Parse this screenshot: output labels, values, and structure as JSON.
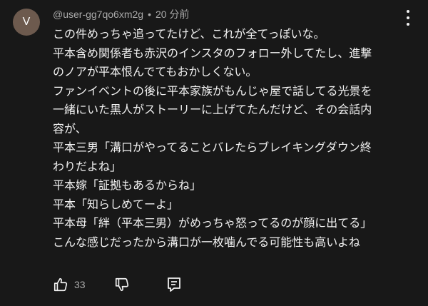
{
  "comment": {
    "avatar_letter": "V",
    "avatar_color": "#6d5a4e",
    "username": "@user-gg7qo6xm2g",
    "separator": "•",
    "timestamp": "20 分前",
    "lines": [
      "この件めっちゃ追ってたけど、これが全てっぽいな。",
      "平本含め関係者も赤沢のインスタのフォロー外してたし、進撃",
      "のノアが平本恨んでてもおかしくない。",
      "ファンイベントの後に平本家族がもんじゃ屋で話してる光景を",
      "一緒にいた黒人がストーリーに上げてたんだけど、その会話内",
      "容が、",
      "平本三男「溝口がやってることバレたらブレイキングダウン終",
      "わりだよね」",
      "平本嫁「証拠もあるからね」",
      "平本「知らしめてーよ」",
      "平本母「絆（平本三男）がめっちゃ怒ってるのが顔に出てる」",
      "こんな感じだったから溝口が一枚噛んでる可能性も高いよね"
    ],
    "like_count": "33"
  },
  "icons": {
    "menu": "more-vert-icon",
    "like": "thumbs-up-icon",
    "dislike": "thumbs-down-icon",
    "reply": "reply-comment-icon"
  }
}
